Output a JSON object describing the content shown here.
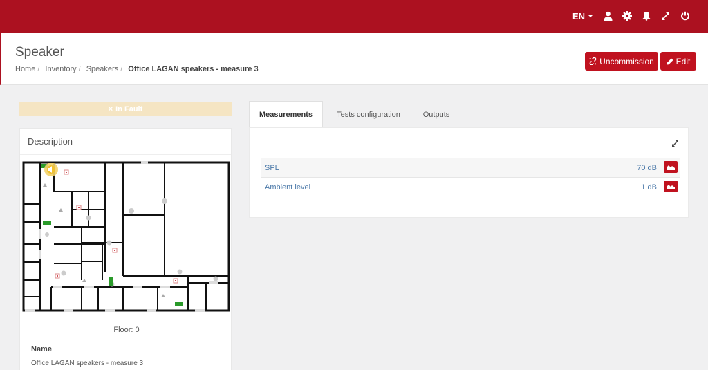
{
  "topbar": {
    "language": "EN",
    "icons": [
      "user-icon",
      "gear-icon",
      "bell-icon",
      "expand-icon",
      "power-icon"
    ]
  },
  "header": {
    "title": "Speaker",
    "breadcrumb": [
      "Home",
      "Inventory",
      "Speakers",
      "Office LAGAN speakers - measure 3"
    ],
    "uncommission_label": "Uncommission",
    "edit_label": "Edit"
  },
  "status": {
    "fault_icon": "×",
    "fault_label": "In Fault"
  },
  "description": {
    "title": "Description",
    "floor_label": "Floor:",
    "floor_value": "0",
    "name_label": "Name",
    "name_value": "Office LAGAN speakers - measure 3"
  },
  "tabs": [
    {
      "label": "Measurements",
      "active": true
    },
    {
      "label": "Tests configuration",
      "active": false
    },
    {
      "label": "Outputs",
      "active": false
    }
  ],
  "measurements": [
    {
      "name": "SPL",
      "value": "70 dB"
    },
    {
      "name": "Ambient level",
      "value": "1 dB"
    }
  ],
  "colors": {
    "brand": "#ac1120",
    "button": "#c0121f",
    "fault_banner": "#f5e5c3",
    "link": "#4a78a8"
  }
}
